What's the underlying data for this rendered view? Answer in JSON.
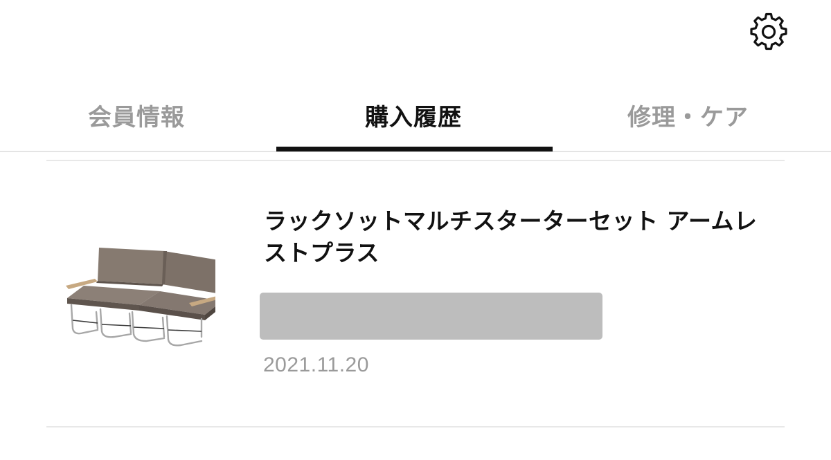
{
  "header": {
    "settings_icon": "gear-icon"
  },
  "tabs": [
    {
      "label": "会員情報",
      "active": false
    },
    {
      "label": "購入履歴",
      "active": true
    },
    {
      "label": "修理・ケア",
      "active": false
    }
  ],
  "purchase": {
    "item": {
      "name": "ラックソットマルチスターターセット アームレストプラス",
      "date": "2021.11.20",
      "thumbnail": "folding-sofa-image"
    }
  },
  "colors": {
    "active_tab": "#111111",
    "inactive_tab": "#9a9a9a",
    "redacted_block": "#bdbdbd",
    "date_text": "#9a9a9a"
  }
}
